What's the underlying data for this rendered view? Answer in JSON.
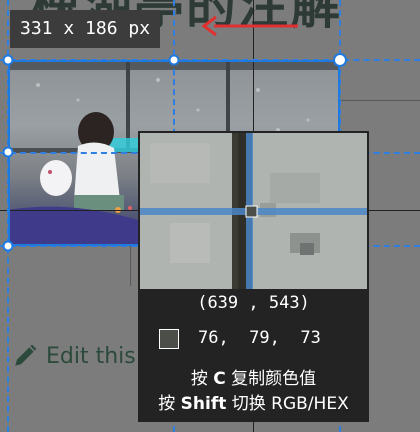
{
  "background_page": {
    "heading_fragment": "",
    "edit_link_label": "Edit this page",
    "edit_icon": "pencil-icon"
  },
  "selection": {
    "size_label": "331 x 186 px",
    "accent_color": "#1f7ae0"
  },
  "magnifier": {
    "coordinate_label": "(639 , 543)",
    "rgb_label": "76,  79,  73",
    "swatch_color": "#4c4f49",
    "hint_copy_prefix": "按",
    "hint_copy_key": "C",
    "hint_copy_suffix": "复制颜色值",
    "hint_switch_prefix": "按",
    "hint_switch_key": "Shift",
    "hint_switch_suffix": "切换 RGB/HEX"
  }
}
